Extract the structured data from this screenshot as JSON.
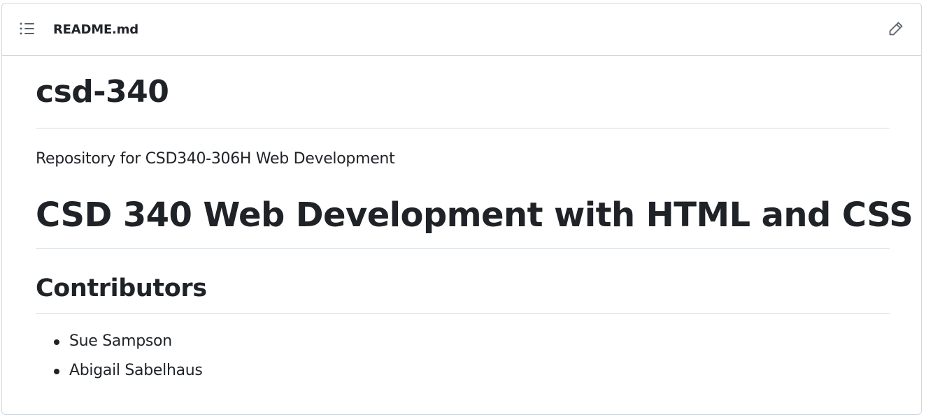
{
  "header": {
    "file_name": "README.md",
    "toc_icon": "list-unordered-icon",
    "edit_icon": "pencil-icon"
  },
  "readme": {
    "title": "csd-340",
    "description": "Repository for CSD340-306H Web Development",
    "course_heading": "CSD 340 Web Development with HTML and CSS",
    "contributors_heading": "Contributors",
    "contributors": [
      "Sue Sampson",
      "Abigail Sabelhaus"
    ]
  },
  "colors": {
    "text": "#1f2328",
    "border": "#d0d7de",
    "icon": "#59636e"
  }
}
